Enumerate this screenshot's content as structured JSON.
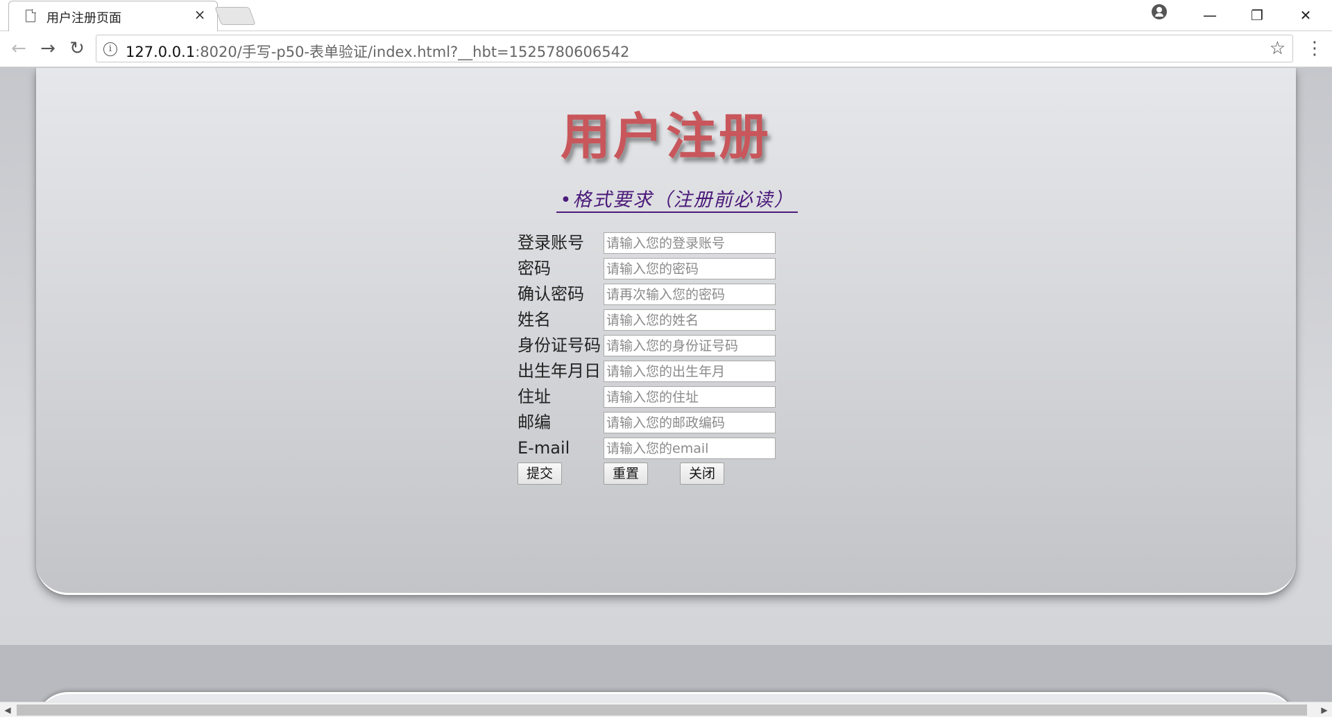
{
  "browser": {
    "tab_title": "用户注册页面",
    "tab_close": "×",
    "url_host": "127.0.0.1",
    "url_rest": ":8020/手写-p50-表单验证/index.html?__hbt=1525780606542",
    "info_glyph": "i",
    "star_glyph": "☆",
    "menu_glyph": "⋮",
    "back_glyph": "←",
    "forward_glyph": "→",
    "reload_glyph": "↻",
    "minimize_glyph": "—",
    "restore_glyph": "❐",
    "close_glyph": "✕"
  },
  "page": {
    "title": "用户注册",
    "requirements_link": "•格式要求（注册前必读）",
    "title_color": "#c8565b",
    "link_color": "#4b1a7a"
  },
  "form": {
    "fields": [
      {
        "label": "登录账号",
        "placeholder": "请输入您的登录账号"
      },
      {
        "label": "密码",
        "placeholder": "请输入您的密码"
      },
      {
        "label": "确认密码",
        "placeholder": "请再次输入您的密码"
      },
      {
        "label": "姓名",
        "placeholder": "请输入您的姓名"
      },
      {
        "label": "身份证号码",
        "placeholder": "请输入您的身份证号码"
      },
      {
        "label": "出生年月日",
        "placeholder": "请输入您的出生年月"
      },
      {
        "label": "住址",
        "placeholder": "请输入您的住址"
      },
      {
        "label": "邮编",
        "placeholder": "请输入您的邮政编码"
      },
      {
        "label": "E-mail",
        "placeholder": "请输入您的email"
      }
    ],
    "submit_label": "提交",
    "reset_label": "重置",
    "close_label": "关闭"
  },
  "scrollbar": {
    "left_arrow": "◀",
    "right_arrow": "▶"
  }
}
